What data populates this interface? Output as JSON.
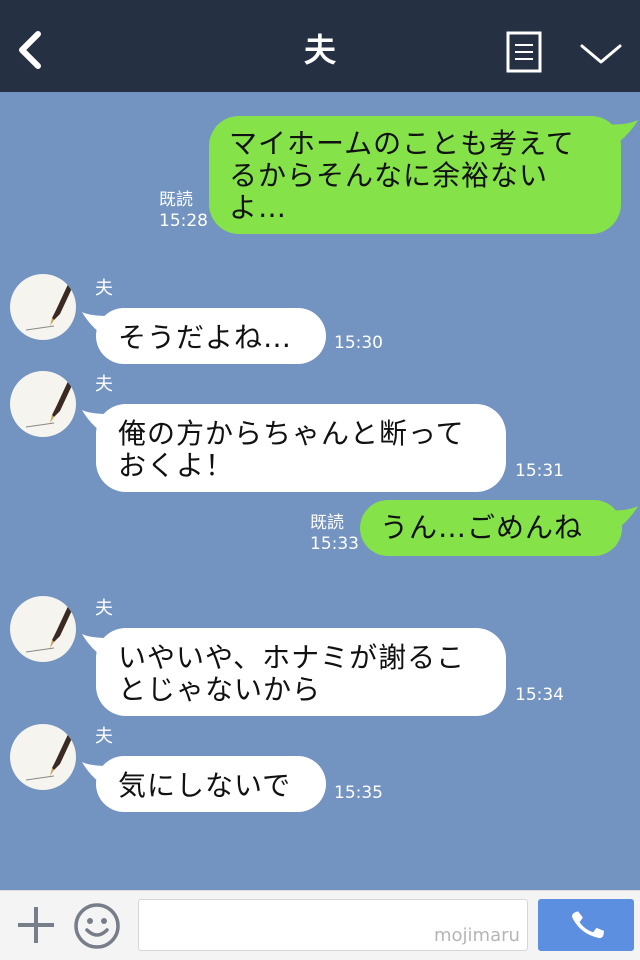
{
  "header": {
    "title": "夫"
  },
  "messages": [
    {
      "side": "out",
      "text": "マイホームのことも考えてるからそんなに余裕ないよ…",
      "read_label": "既読",
      "time": "15:28"
    },
    {
      "side": "in",
      "sender": "夫",
      "text": "そうだよね…",
      "time": "15:30"
    },
    {
      "side": "in",
      "sender": "夫",
      "text": "俺の方からちゃんと断っておくよ！",
      "time": "15:31"
    },
    {
      "side": "out",
      "text": "うん…ごめんね",
      "read_label": "既読",
      "time": "15:33"
    },
    {
      "side": "in",
      "sender": "夫",
      "text": "いやいや、ホナミが謝ることじゃないから",
      "time": "15:34"
    },
    {
      "side": "in",
      "sender": "夫",
      "text": "気にしないで",
      "time": "15:35"
    }
  ],
  "footer": {
    "input_value": "",
    "watermark": "mojimaru"
  },
  "icons": {
    "back": "chevron-left-icon",
    "menu": "document-list-icon",
    "collapse": "chevron-down-icon",
    "add": "plus-icon",
    "emoji": "smiley-icon",
    "call": "phone-icon"
  },
  "colors": {
    "header_bg": "#253043",
    "chat_bg": "#7393c0",
    "outgoing_bubble": "#85e249",
    "incoming_bubble": "#ffffff",
    "call_button": "#5c8fe0"
  }
}
